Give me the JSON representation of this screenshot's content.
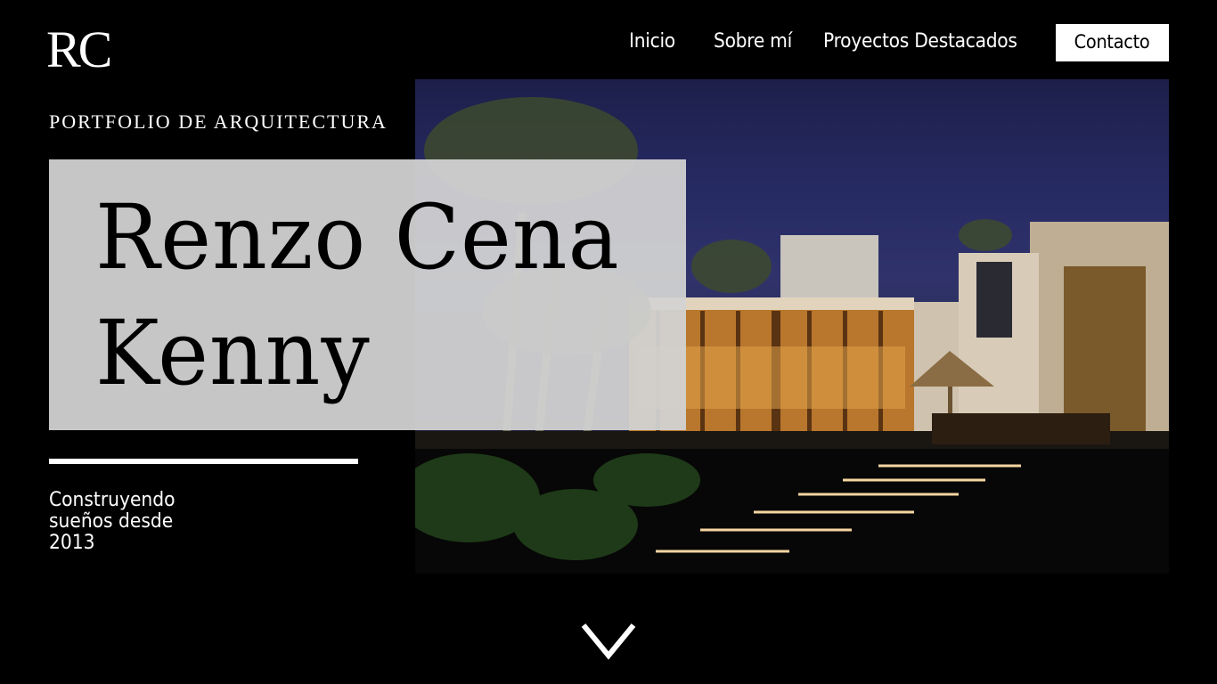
{
  "logo": {
    "text": "RC"
  },
  "nav": {
    "items": [
      {
        "label": "Inicio"
      },
      {
        "label": "Sobre mí"
      },
      {
        "label": "Proyectos Destacados"
      },
      {
        "label": "Contacto"
      }
    ]
  },
  "hero": {
    "subtitle": "PORTFOLIO DE ARQUITECTURA",
    "name_line1": "Renzo Cena",
    "name_line2": "Kenny",
    "tagline": "Construyendo sueños desde 2013"
  },
  "icons": {
    "scroll": "chevron-down-icon"
  },
  "colors": {
    "background": "#000000",
    "name_box": "#d2d2d2",
    "text": "#ffffff"
  }
}
